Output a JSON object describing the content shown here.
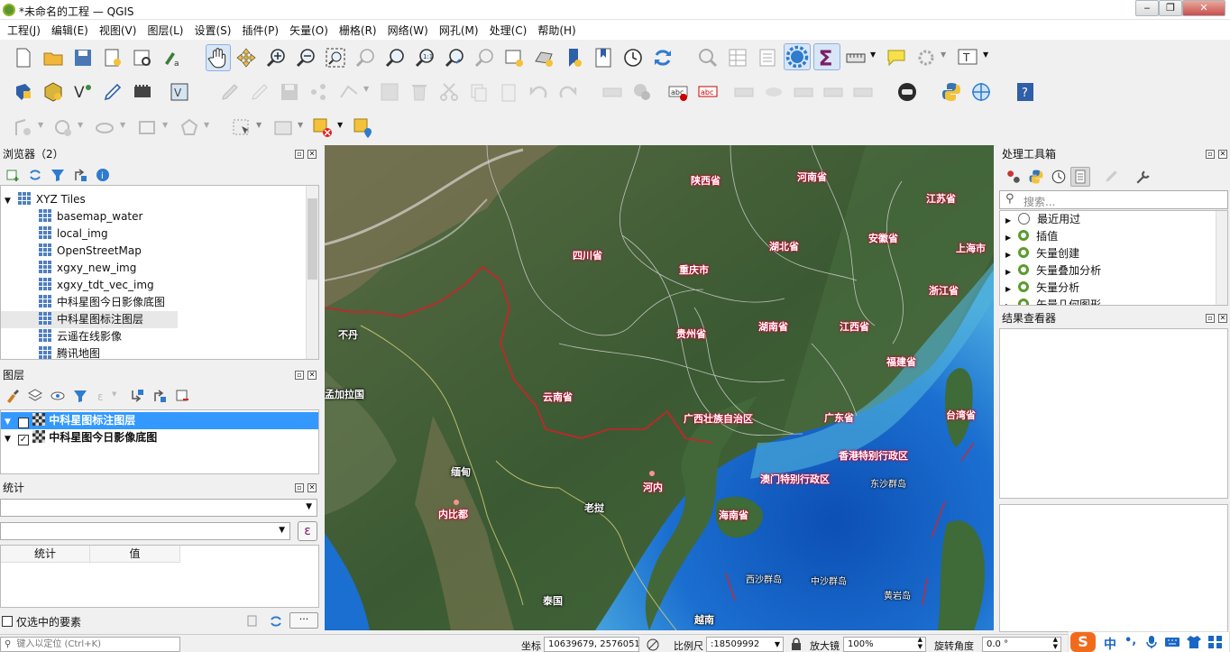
{
  "window": {
    "title": "*未命名的工程 — QGIS",
    "min": "‒",
    "max": "❐",
    "close": "✕"
  },
  "menu": [
    "工程(J)",
    "编辑(E)",
    "视图(V)",
    "图层(L)",
    "设置(S)",
    "插件(P)",
    "矢量(O)",
    "栅格(R)",
    "网络(W)",
    "网孔(M)",
    "处理(C)",
    "帮助(H)"
  ],
  "browser": {
    "title": "浏览器（2）",
    "root": "XYZ Tiles",
    "items": [
      "basemap_water",
      "local_img",
      "OpenStreetMap",
      "xgxy_new_img",
      "xgxy_tdt_vec_img",
      "中科星图今日影像底图",
      "中科星图标注图层",
      "云遥在线影像",
      "腾讯地图"
    ]
  },
  "layers": {
    "title": "图层",
    "items": [
      {
        "name": "中科星图标注图层",
        "checked": true,
        "selected": true
      },
      {
        "name": "中科星图今日影像底图",
        "checked": true,
        "selected": false
      }
    ]
  },
  "stats": {
    "title": "统计",
    "col_stat": "统计",
    "col_value": "值",
    "selected_only": "仅选中的要素",
    "expr_btn": "ε",
    "more_btn": "···"
  },
  "processing": {
    "title": "处理工具箱",
    "search_placeholder": "搜索...",
    "items": [
      "最近用过",
      "插值",
      "矢量创建",
      "矢量叠加分析",
      "矢量分析",
      "矢量几何图形"
    ]
  },
  "results": {
    "title": "结果查看器"
  },
  "map_labels": {
    "shaanxi": "陕西省",
    "henan": "河南省",
    "jiangsu": "江苏省",
    "sichuan": "四川省",
    "hubei": "湖北省",
    "anhui": "安徽省",
    "shanghai": "上海市",
    "chongqing": "重庆市",
    "zhejiang": "浙江省",
    "guizhou": "贵州省",
    "hunan": "湖南省",
    "jiangxi": "江西省",
    "fujian": "福建省",
    "yunnan": "云南省",
    "guangxi": "广西壮族自治区",
    "guangdong": "广东省",
    "taiwan": "台湾省",
    "hongkong": "香港特别行政区",
    "macau": "澳门特别行政区",
    "hainan": "海南省",
    "bhutan": "不丹",
    "bangladesh": "孟加拉国",
    "myanmar": "缅甸",
    "hanoi": "河内",
    "naypyidaw": "内比都",
    "laos": "老挝",
    "thailand": "泰国",
    "vietnam": "越南",
    "dongsha": "东沙群岛",
    "xisha": "西沙群岛",
    "zhongsha": "中沙群岛",
    "huangyan": "黄岩岛"
  },
  "status": {
    "locator_placeholder": "键入以定位 (Ctrl+K)",
    "coord_label": "坐标",
    "coord_value": "10639679, 2576051",
    "scale_label": "比例尺",
    "scale_value": ":18509992",
    "magnifier_label": "放大镜",
    "magnifier_value": "100%",
    "rotation_label": "旋转角度",
    "rotation_value": "0.0 °"
  },
  "ime": {
    "s": "S",
    "zh": "中",
    "punct": "•,"
  },
  "colors": {
    "selection": "#3399ff",
    "label_halo": "#cc0033",
    "border": "#cc0000"
  }
}
